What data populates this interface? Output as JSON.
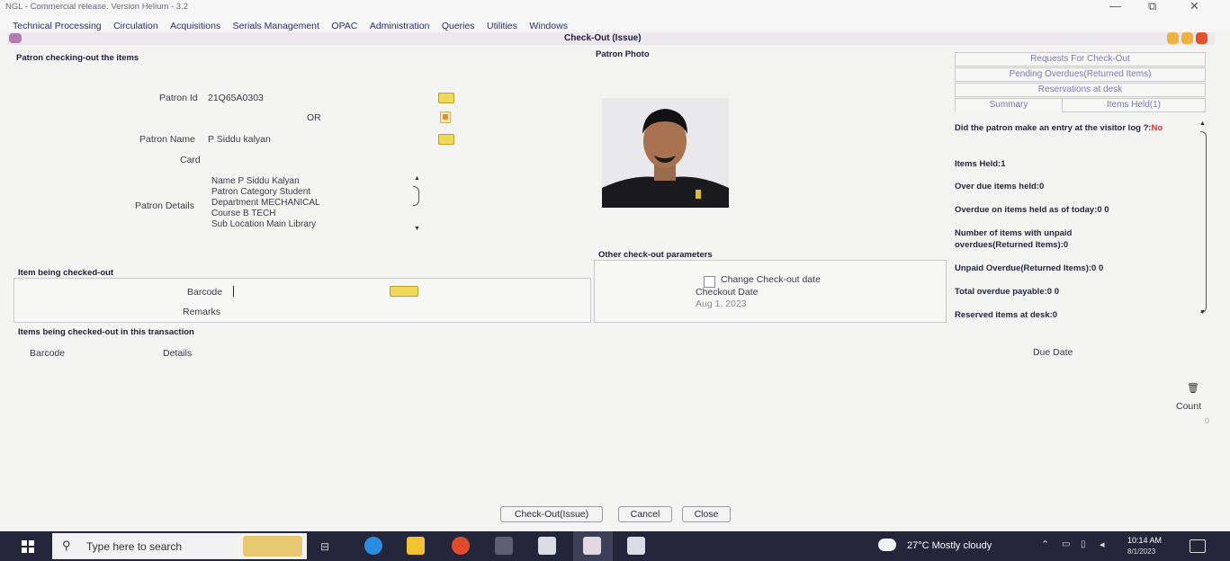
{
  "title_bar": {
    "title": "NGL - Commercial release. Version Helium - 3.2",
    "minimize": "—",
    "restore": "⧉",
    "close": "✕"
  },
  "menu": [
    "Technical Processing",
    "Circulation",
    "Acquisitions",
    "Serials Management",
    "OPAC",
    "Administration",
    "Queries",
    "Utilities",
    "Windows"
  ],
  "window": {
    "title": "Check-Out (Issue)"
  },
  "patron": {
    "section_title": "Patron checking-out the items",
    "id_label": "Patron Id",
    "id_value": "21Q65A0303",
    "or_label": "OR",
    "name_label": "Patron Name",
    "name_value": "P Siddu kalyan",
    "card_label": "Card",
    "details_label": "Patron Details",
    "details_lines": [
      "Name  P Siddu Kalyan",
      "Patron Category  Student",
      "Department  MECHANICAL",
      "Course  B TECH",
      "Sub Location  Main Library"
    ],
    "photo_label": "Patron Photo"
  },
  "item": {
    "section_title": "Item being checked-out",
    "barcode_label": "Barcode",
    "remarks_label": "Remarks"
  },
  "transaction": {
    "section_title": "Items being checked-out in this transaction",
    "columns": {
      "barcode": "Barcode",
      "details": "Details",
      "due_date": "Due Date"
    },
    "count_label": "Count",
    "count_value": "0"
  },
  "other_params": {
    "title": "Other check-out parameters",
    "change_date_label": "Change Check-out date",
    "checkout_date_label": "Checkout Date",
    "checkout_date_value": "Aug 1, 2023"
  },
  "right_tabs": {
    "requests": "Requests For Check-Out",
    "pending": "Pending Overdues(Returned Items)",
    "reservations": "Reservations at desk",
    "summary": "Summary",
    "items_held": "Items Held(1)"
  },
  "summary": {
    "visitor_q": "Did the patron make an entry at the visitor log ?:",
    "visitor_a": "No",
    "items_held": "Items Held:1",
    "over_due": "Over due items held:0",
    "overdue_today": "Overdue on items held as of today:0 0",
    "unpaid_count": "Number of items with unpaid overdues(Returned Items):0",
    "unpaid_overdue": "Unpaid Overdue(Returned Items):0 0",
    "total_payable": "Total overdue payable:0 0",
    "reserved": "Reserved items at desk:0"
  },
  "buttons": {
    "checkout": "Check-Out(Issue)",
    "cancel": "Cancel",
    "close": "Close"
  },
  "taskbar": {
    "search_placeholder": "Type here to search",
    "weather": "27°C  Mostly cloudy",
    "time": "10:14 AM",
    "date": "8/1/2023"
  },
  "colors": {
    "accent_link": "#7c78b6",
    "highlight_no": "#e03030",
    "taskbar": "#23253a"
  }
}
